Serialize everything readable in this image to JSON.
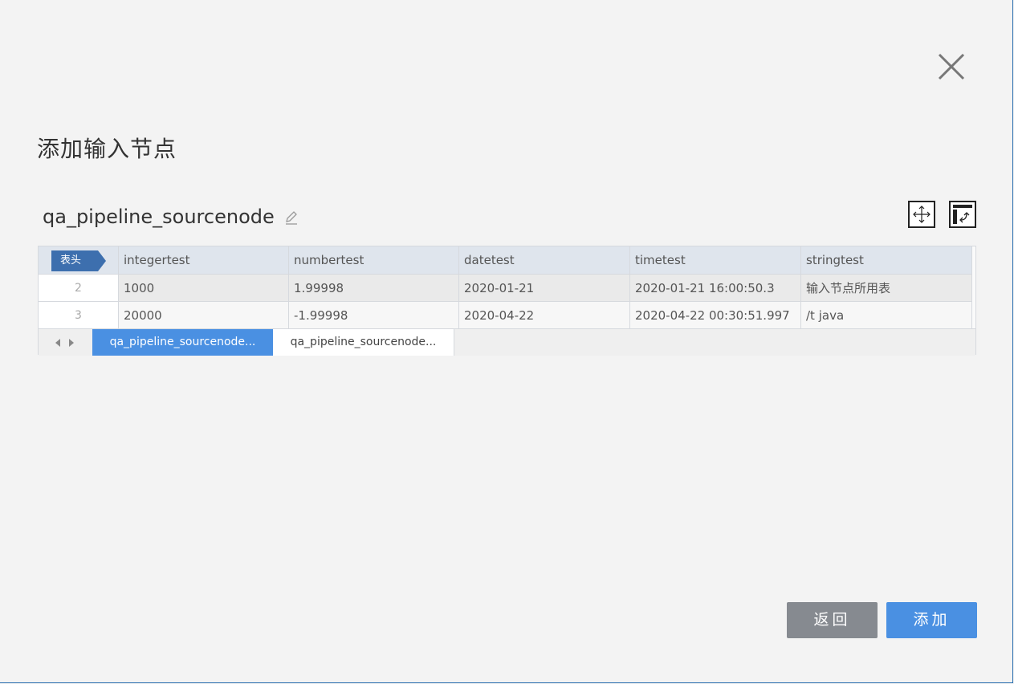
{
  "dialog": {
    "title": "添加输入节点",
    "node_name": "qa_pipeline_sourcenode"
  },
  "grid": {
    "header_tag": "表头",
    "columns": [
      "integertest",
      "numbertest",
      "datetest",
      "timetest",
      "stringtest"
    ],
    "rows": [
      {
        "num": "2",
        "cells": [
          "1000",
          "1.99998",
          "2020-01-21",
          "2020-01-21 16:00:50.3",
          "输入节点所用表"
        ]
      },
      {
        "num": "3",
        "cells": [
          "20000",
          "-1.99998",
          "2020-04-22",
          "2020-04-22 00:30:51.997",
          "/t java"
        ]
      }
    ]
  },
  "sheets": [
    "qa_pipeline_sourcenode...",
    "qa_pipeline_sourcenode..."
  ],
  "buttons": {
    "back": "返回",
    "add": "添加"
  },
  "colors": {
    "primary": "#4a90e2",
    "secondary": "#868a90",
    "header_tag": "#3d6fae"
  }
}
